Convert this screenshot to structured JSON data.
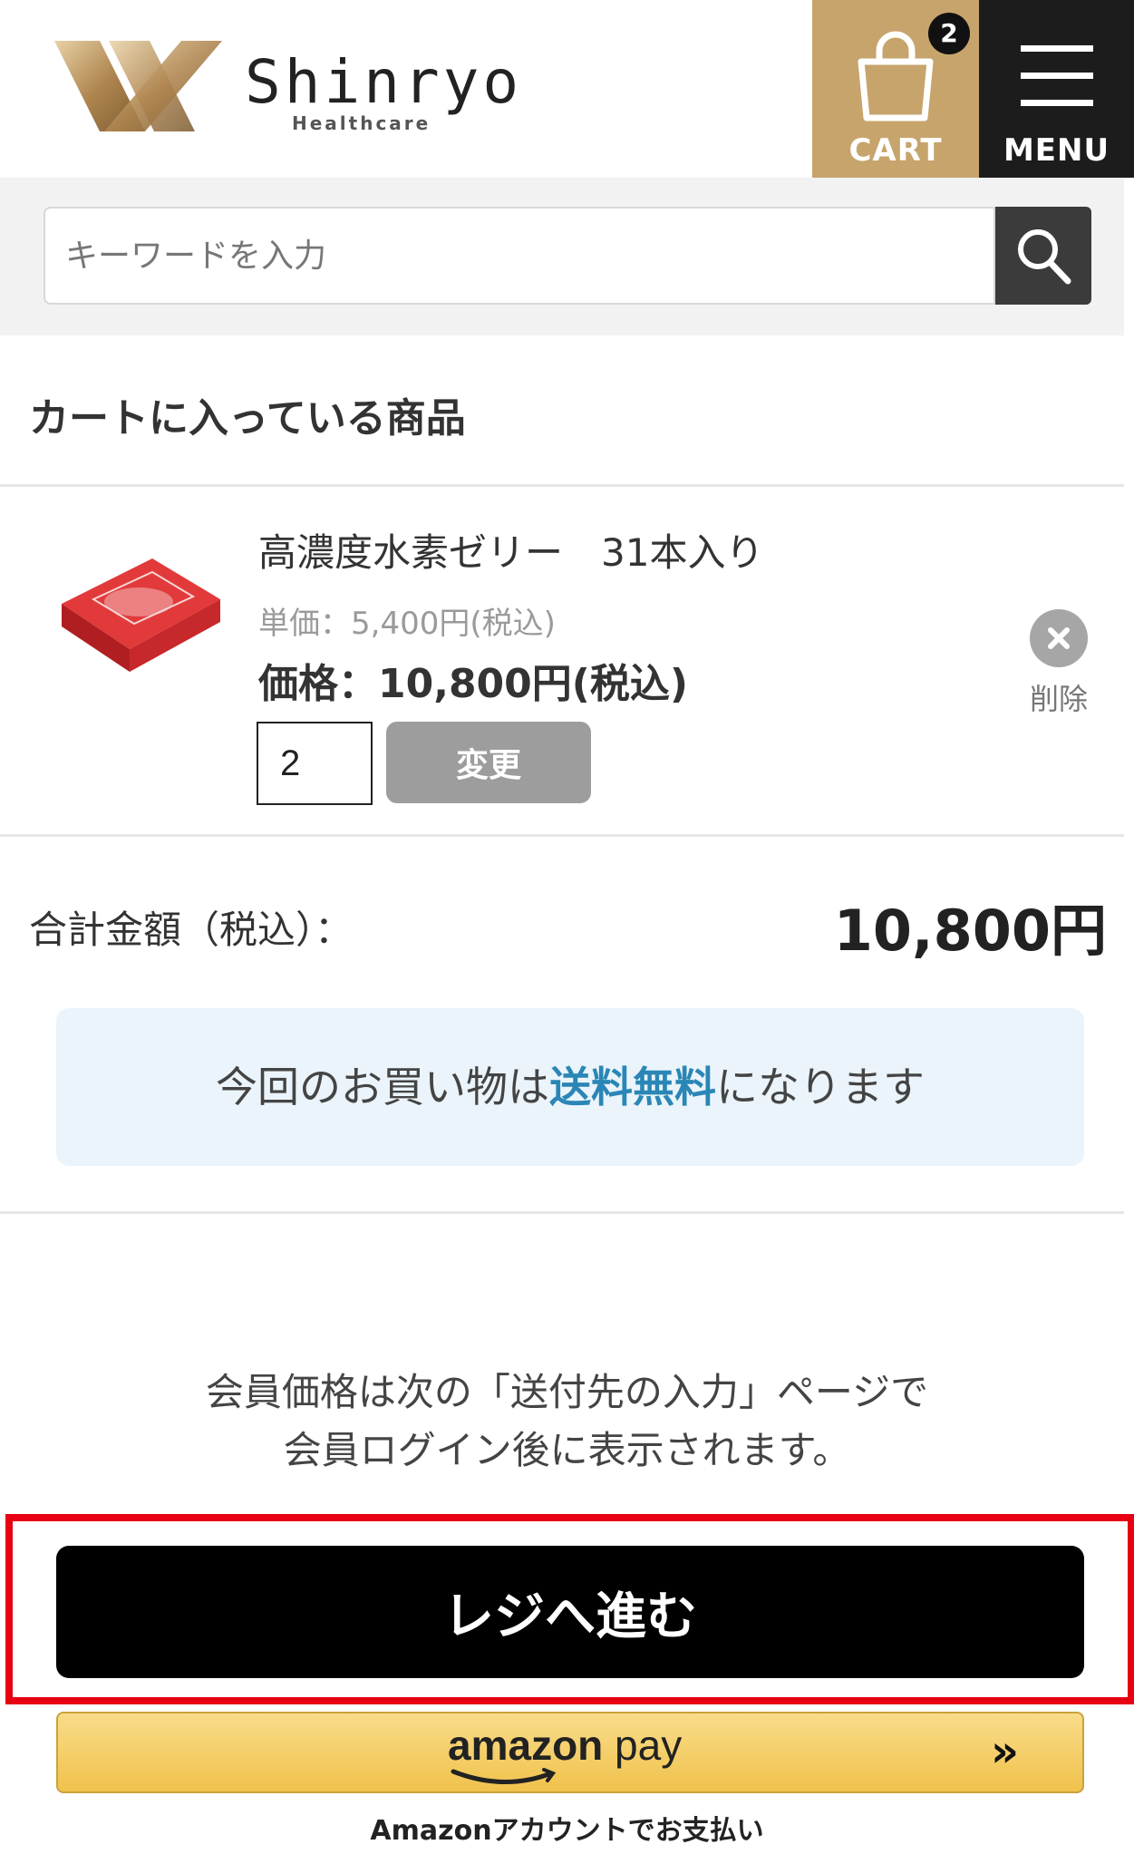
{
  "header": {
    "logo_name": "Shinryo",
    "logo_sub": "Healthcare",
    "cart_label": "CART",
    "cart_count": "2",
    "menu_label": "MENU"
  },
  "search": {
    "placeholder": "キーワードを入力"
  },
  "cart": {
    "section_title": "カートに入っている商品",
    "items": [
      {
        "name": "高濃度水素ゼリー　31本入り",
        "unit_price": "単価：5,400円(税込)",
        "line_price": "価格：10,800円(税込)",
        "quantity": "2",
        "change_label": "変更",
        "delete_label": "削除"
      }
    ],
    "total_label": "合計金額（税込）：",
    "total_value": "10,800円",
    "shipping_pre": "今回のお買い物は",
    "shipping_em": "送料無料",
    "shipping_post": "になります"
  },
  "note": {
    "line1": "会員価格は次の「送付先の入力」ページで",
    "line2": "会員ログイン後に表示されます。"
  },
  "actions": {
    "checkout_label": "レジへ進む",
    "amazon_logo_a": "amazon",
    "amazon_logo_b": "pay",
    "amazon_arrows": "»",
    "amazon_caption": "Amazonアカウントでお支払い"
  },
  "colors": {
    "brand_gold": "#c6a46b",
    "highlight_red": "#e60012",
    "shipping_accent": "#2a86b6"
  }
}
